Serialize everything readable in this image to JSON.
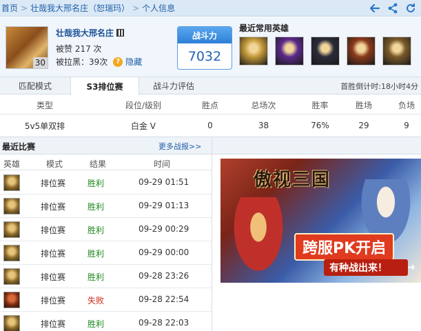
{
  "breadcrumb": {
    "home": "首页",
    "sep1": ">",
    "player": "壮哉我大邢名庄（恕瑞玛）",
    "sep2": ">",
    "current": "个人信息"
  },
  "top_icons": [
    "back-arrow-icon",
    "share-icon",
    "refresh-icon"
  ],
  "profile": {
    "name": "壮哉我大邢名庄",
    "level": "30",
    "praise": "被赞 217 次",
    "blacklisted": "被拉黑：39次",
    "hide_label": "隐藏"
  },
  "power": {
    "label": "战斗力",
    "value": "7032"
  },
  "recent_heroes": {
    "title": "最近常用英雄",
    "colors": [
      "#c49a3a",
      "#5b2a8a",
      "#2b2b3a",
      "#8a3a1a",
      "#7a5a2a"
    ]
  },
  "tabs": [
    {
      "label": "匹配模式"
    },
    {
      "label": "S3排位赛"
    },
    {
      "label": "战斗力评估"
    }
  ],
  "countdown": "首胜倒计时:18小时4分",
  "stats": {
    "headers": [
      "类型",
      "段位/级别",
      "胜点",
      "总场次",
      "胜率",
      "胜场",
      "负场"
    ],
    "row": [
      "5v5单双排",
      "白金 V",
      "0",
      "38",
      "76%",
      "29",
      "9"
    ]
  },
  "recent": {
    "title": "最近比赛",
    "more": "更多战报>>",
    "headers": [
      "英雄",
      "模式",
      "结果",
      "时间"
    ],
    "matches": [
      {
        "mode": "排位赛",
        "result": "胜利",
        "time": "09-29 01:51",
        "win": true
      },
      {
        "mode": "排位赛",
        "result": "胜利",
        "time": "09-29 01:13",
        "win": true
      },
      {
        "mode": "排位赛",
        "result": "胜利",
        "time": "09-29 00:29",
        "win": true
      },
      {
        "mode": "排位赛",
        "result": "胜利",
        "time": "09-29 00:00",
        "win": true
      },
      {
        "mode": "排位赛",
        "result": "胜利",
        "time": "09-28 23:26",
        "win": true
      },
      {
        "mode": "排位赛",
        "result": "失败",
        "time": "09-28 22:54",
        "win": false
      },
      {
        "mode": "排位赛",
        "result": "胜利",
        "time": "09-28 22:03",
        "win": true
      }
    ]
  },
  "ad": {
    "title": "傲视三国",
    "tag": "跨服PK开启",
    "sub": "有种战出来！"
  }
}
